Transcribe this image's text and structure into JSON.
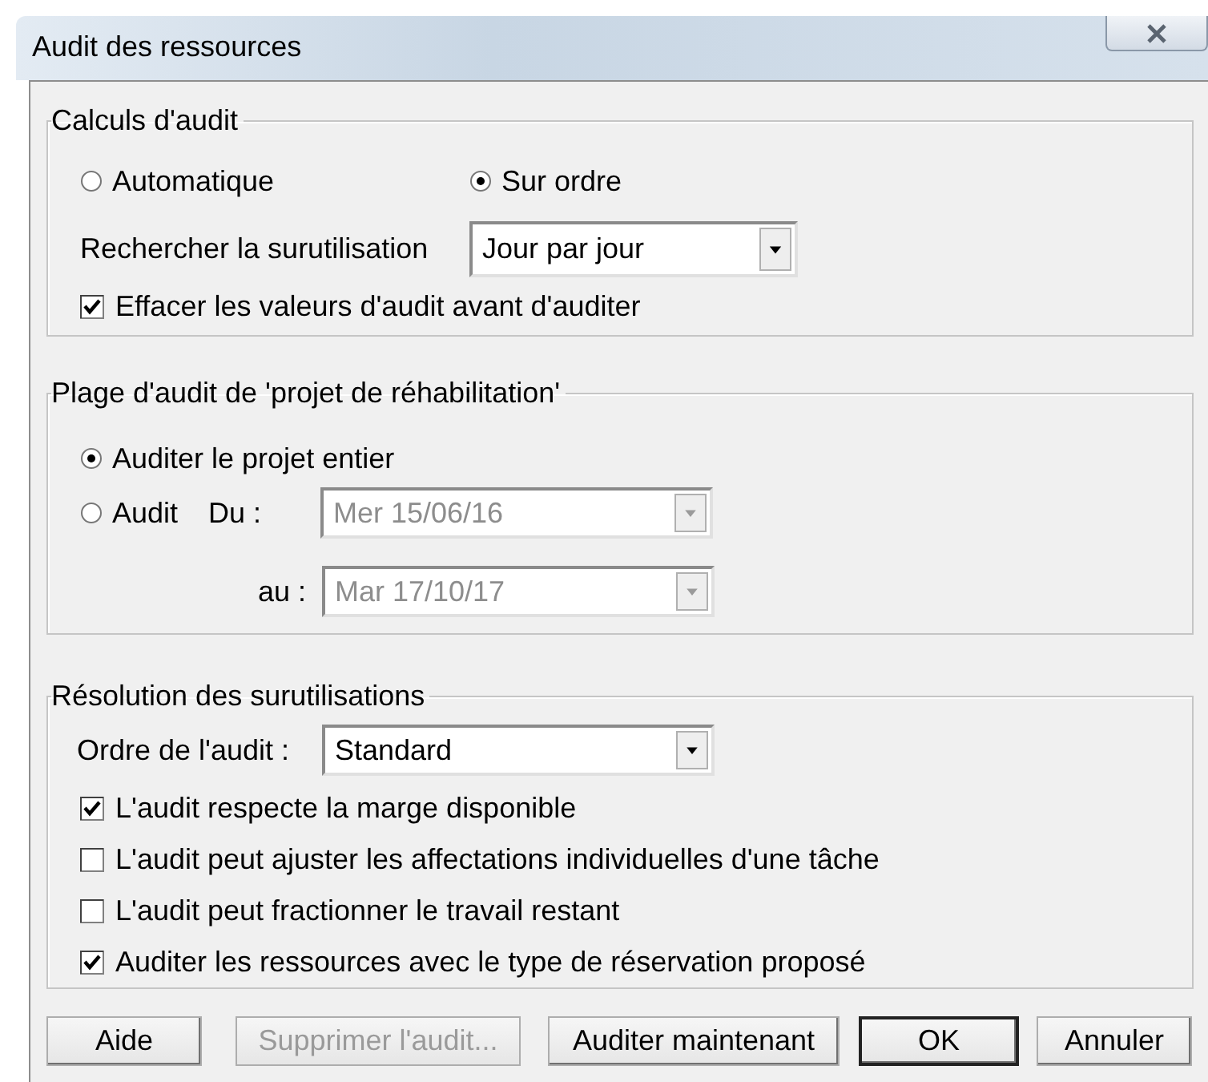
{
  "window": {
    "title": "Audit des ressources"
  },
  "calculs": {
    "title": "Calculs d'audit",
    "modes": [
      {
        "label": "Automatique",
        "selected": false
      },
      {
        "label": "Sur ordre",
        "selected": true
      }
    ],
    "search": {
      "label": "Rechercher la surutilisation",
      "value": "Jour par jour"
    },
    "clear_values": {
      "label": "Effacer les valeurs d'audit avant d'auditer",
      "checked": true
    }
  },
  "range": {
    "title": "Plage d'audit de 'projet de réhabilitation'",
    "options": [
      {
        "label": "Auditer le projet entier",
        "selected": true
      },
      {
        "label": "Audit",
        "selected": false
      }
    ],
    "from": {
      "label": "Du :",
      "value": "Mer 15/06/16",
      "disabled": true
    },
    "to": {
      "label": "au :",
      "value": "Mar 17/10/17",
      "disabled": true
    }
  },
  "resolution": {
    "title": "Résolution des surutilisations",
    "order": {
      "label": "Ordre de l'audit :",
      "value": "Standard"
    },
    "options": [
      {
        "label": "L'audit respecte la marge disponible",
        "checked": true
      },
      {
        "label": "L'audit peut ajuster les affectations individuelles d'une tâche",
        "checked": false
      },
      {
        "label": "L'audit peut fractionner le travail restant",
        "checked": false
      },
      {
        "label": "Auditer les ressources avec le type de réservation proposé",
        "checked": true
      }
    ]
  },
  "buttons": [
    {
      "label": "Aide",
      "disabled": false,
      "default": false
    },
    {
      "label": "Supprimer l'audit...",
      "disabled": true,
      "default": false
    },
    {
      "label": "Auditer maintenant",
      "disabled": false,
      "default": false
    },
    {
      "label": "OK",
      "disabled": false,
      "default": true
    },
    {
      "label": "Annuler",
      "disabled": false,
      "default": false
    }
  ]
}
